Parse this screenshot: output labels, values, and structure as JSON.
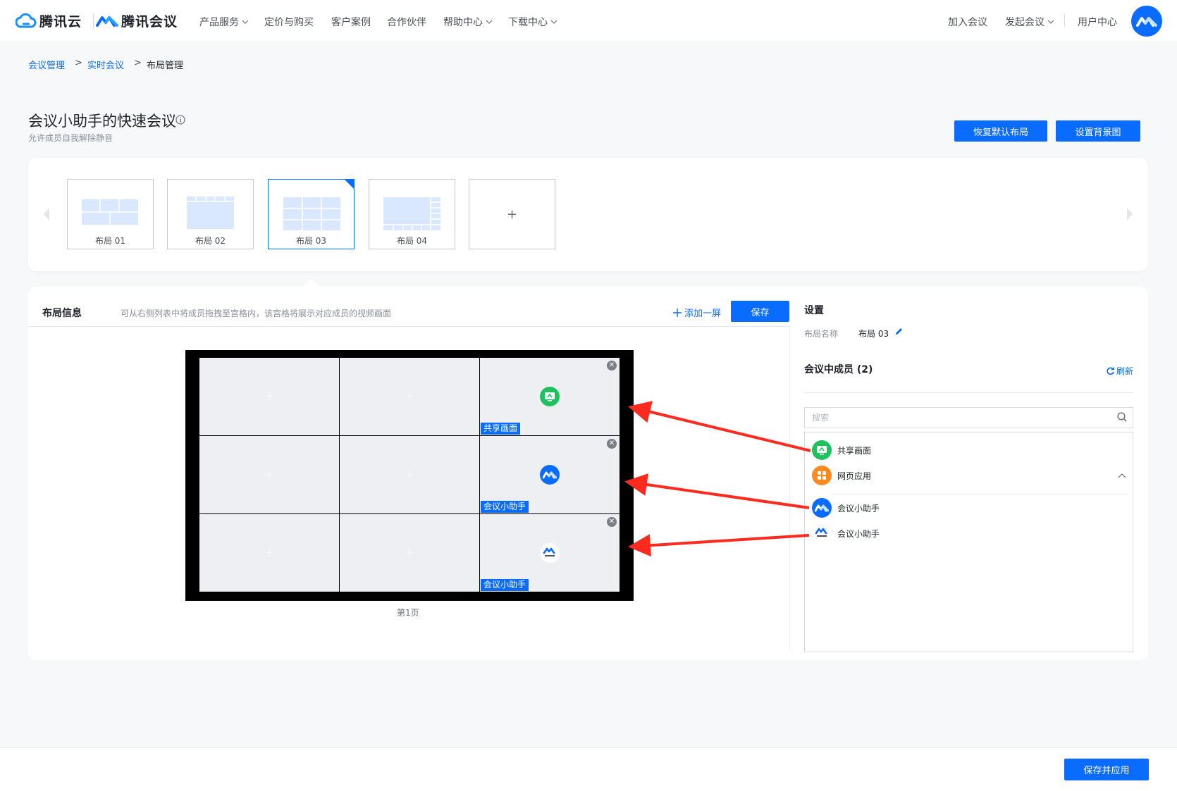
{
  "brand": {
    "cloud_name": "腾讯云",
    "meeting_name": "腾讯会议"
  },
  "nav": {
    "items": [
      {
        "label": "产品服务",
        "dropdown": true
      },
      {
        "label": "定价与购买",
        "dropdown": false
      },
      {
        "label": "客户案例",
        "dropdown": false
      },
      {
        "label": "合作伙伴",
        "dropdown": false
      },
      {
        "label": "帮助中心",
        "dropdown": true
      },
      {
        "label": "下载中心",
        "dropdown": true
      }
    ],
    "right": [
      {
        "label": "加入会议",
        "dropdown": false
      },
      {
        "label": "发起会议",
        "dropdown": true
      },
      {
        "label": "用户中心",
        "dropdown": false
      }
    ]
  },
  "breadcrumb": {
    "items": [
      "会议管理",
      "实时会议",
      "布局管理"
    ],
    "separator": ">"
  },
  "page": {
    "title": "会议小助手的快速会议",
    "subtitle": "允许成员自我解除静音",
    "restore_default_label": "恢复默认布局",
    "set_background_label": "设置背景图"
  },
  "layouts": {
    "items": [
      "布局 01",
      "布局 02",
      "布局 03",
      "布局 04"
    ],
    "selected": "布局 03",
    "add_label": "+"
  },
  "layout_info": {
    "title": "布局信息",
    "description": "可从右侧列表中将成员拖拽至宫格内，该宫格将展示对应成员的视频画面",
    "add_screen_label": "添加一屏",
    "save_label": "保存",
    "page_label": "第1页",
    "cells": [
      {
        "tag": ""
      },
      {
        "tag": ""
      },
      {
        "tag": "共享画面",
        "icon": "screen-share-icon"
      },
      {
        "tag": ""
      },
      {
        "tag": ""
      },
      {
        "tag": "会议小助手",
        "icon": "meeting-logo-icon"
      },
      {
        "tag": ""
      },
      {
        "tag": ""
      },
      {
        "tag": "会议小助手",
        "icon": "tencent-meeting-badge-icon"
      }
    ]
  },
  "settings": {
    "title": "设置",
    "layout_name_label": "布局名称",
    "layout_name_value": "布局 03",
    "members_title": "会议中成员 (2)",
    "refresh_label": "刷新",
    "search_placeholder": "搜索",
    "members": [
      {
        "name": "共享画面",
        "icon": "screen-share-icon",
        "color": "#1cc25e"
      },
      {
        "name": "网页应用",
        "icon": "web-app-icon",
        "color": "#ff8a1f"
      },
      {
        "name": "会议小助手",
        "icon": "meeting-logo-icon",
        "color": "#0a6cff"
      },
      {
        "name": "会议小助手",
        "icon": "tencent-meeting-badge-icon",
        "color": "#ffffff"
      }
    ]
  },
  "footer": {
    "save_apply_label": "保存并应用"
  },
  "colors": {
    "primary": "#0a6cff",
    "share_green": "#1cc25e",
    "web_orange": "#ff8a1f",
    "annotation_red": "#ff2a1f"
  }
}
